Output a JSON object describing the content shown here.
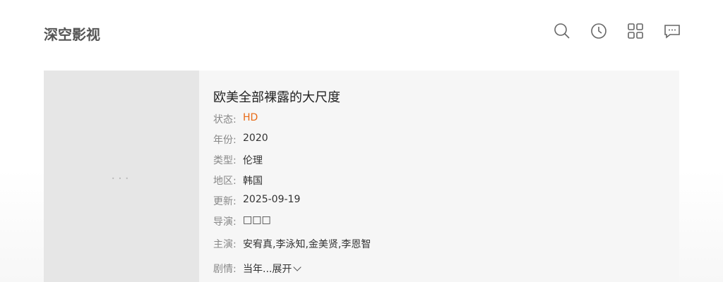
{
  "header": {
    "logo": "深空影视",
    "icons": [
      "search-icon",
      "history-icon",
      "category-grid-icon",
      "message-icon"
    ]
  },
  "movie": {
    "title": "欧美全部裸露的大尺度",
    "status_label": "状态:",
    "status_value": "HD",
    "year_label": "年份:",
    "year_value": "2020",
    "type_label": "类型:",
    "type_value": "伦理",
    "region_label": "地区:",
    "region_value": "韩国",
    "updated_label": "更新:",
    "updated_value": "2025-09-19",
    "director_label": "导演:",
    "director_value": "□□□",
    "cast_label": "主演:",
    "cast_value": "安宥真,李泳知,金美贤,李恩智",
    "plot_label": "剧情:",
    "plot_value": "当年...",
    "expand_label": "展开"
  },
  "poster": {
    "placeholder": "..."
  },
  "colors": {
    "accent": "#e86a15",
    "card_bg": "#f6f6f6",
    "poster_bg": "#e6e6e6"
  }
}
